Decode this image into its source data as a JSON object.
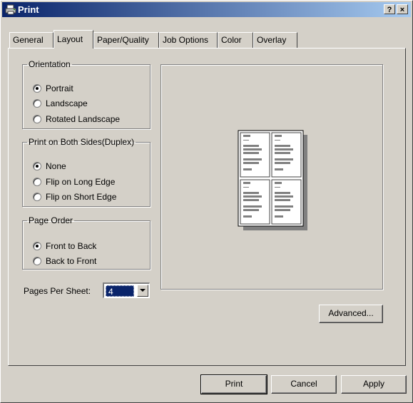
{
  "window": {
    "title": "Print",
    "help_label": "?",
    "close_label": "×"
  },
  "tabs": [
    {
      "label": "General",
      "active": false
    },
    {
      "label": "Layout",
      "active": true
    },
    {
      "label": "Paper/Quality",
      "active": false
    },
    {
      "label": "Job Options",
      "active": false
    },
    {
      "label": "Color",
      "active": false
    },
    {
      "label": "Overlay",
      "active": false
    }
  ],
  "orientation": {
    "legend": "Orientation",
    "options": [
      "Portrait",
      "Landscape",
      "Rotated Landscape"
    ],
    "selected": "Portrait"
  },
  "duplex": {
    "legend": "Print on Both Sides(Duplex)",
    "options": [
      "None",
      "Flip on Long Edge",
      "Flip on Short Edge"
    ],
    "selected": "None"
  },
  "page_order": {
    "legend": "Page Order",
    "options": [
      "Front to Back",
      "Back to Front"
    ],
    "selected": "Front to Back"
  },
  "pages_per_sheet": {
    "label": "Pages Per Sheet:",
    "value": "4"
  },
  "preview": {
    "pages_per_sheet": 4
  },
  "buttons": {
    "advanced": "Advanced...",
    "print": "Print",
    "cancel": "Cancel",
    "apply": "Apply"
  },
  "colors": {
    "title_start": "#0a246a",
    "title_end": "#a6caf0",
    "face": "#d4d0c8",
    "selection": "#0a246a"
  }
}
